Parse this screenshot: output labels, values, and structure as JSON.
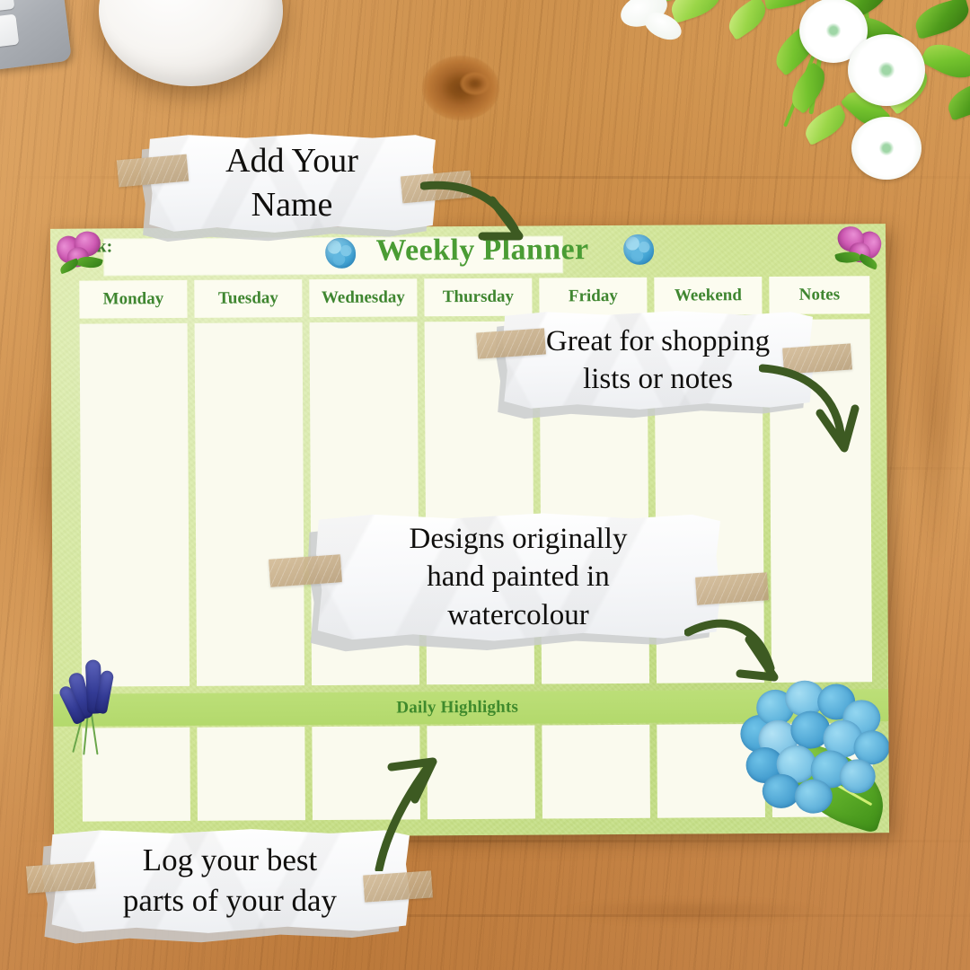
{
  "scene": {
    "description": "Weekly Planner notepad mockup on a wooden desk",
    "desk_items": [
      "keyboard",
      "coffee-cup",
      "potted-plant-with-white-flowers"
    ]
  },
  "planner": {
    "title": "Weekly Planner",
    "week_label": "Week:",
    "columns": [
      "Monday",
      "Tuesday",
      "Wednesday",
      "Thursday",
      "Friday",
      "Weekend",
      "Notes"
    ],
    "highlights_label": "Daily Highlights",
    "decorations": [
      "pink-orchid-top-left",
      "blue-hydrangea-bloom-left",
      "blue-hydrangea-bloom-right",
      "pink-orchid-top-right",
      "lavender-sprig-bottom-left",
      "blue-hydrangea-bottom-right"
    ]
  },
  "notes": [
    {
      "id": "name",
      "text": "Add Your\nName"
    },
    {
      "id": "shopping",
      "text": "Great for shopping\nlists or notes"
    },
    {
      "id": "watercolour",
      "text": "Designs originally\nhand painted in\nwatercolour"
    },
    {
      "id": "log",
      "text": "Log your best\nparts of your day"
    }
  ],
  "colors": {
    "sheet_green": "#d4e89a",
    "band_green": "#b3d96c",
    "title_green": "#4a9c34",
    "heading_green": "#3f8630",
    "cell_cream": "#fafaee",
    "wood_brown": "#d2904a",
    "arrow_green": "#3d5a22",
    "tape_tan": "#c9ae87",
    "note_white": "#f6f7f9",
    "hydrangea_blue": "#46a7d6",
    "orchid_pink": "#cf5bb4",
    "lavender_purple": "#343c96"
  }
}
